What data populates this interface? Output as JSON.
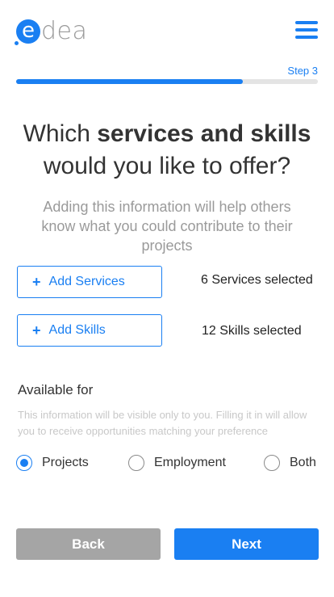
{
  "brand": {
    "logo_mark": "e",
    "logo_rest": "dea",
    "accent_color": "#1a7ff2"
  },
  "header": {
    "menu_icon": "hamburger-menu-icon"
  },
  "progress": {
    "step_label": "Step 3",
    "fraction": 0.75
  },
  "heading": {
    "line1_plain": "Which ",
    "line1_bold": "services and skills",
    "line2": "would you like to offer?"
  },
  "subtitle": "Adding this information will help others know what you could contribute to their projects",
  "services": {
    "button_label": "Add Services",
    "selected_text": "6 Services selected"
  },
  "skills": {
    "button_label": "Add Skills",
    "selected_text": "12 Skills selected"
  },
  "availability": {
    "title": "Available for",
    "note": "This information will be visible only to you. Filling it in will allow you to receive opportunities matching your preference",
    "options": [
      {
        "label": "Projects",
        "checked": true
      },
      {
        "label": "Employment",
        "checked": false
      },
      {
        "label": "Both",
        "checked": false
      }
    ]
  },
  "footer": {
    "back_label": "Back",
    "next_label": "Next"
  }
}
